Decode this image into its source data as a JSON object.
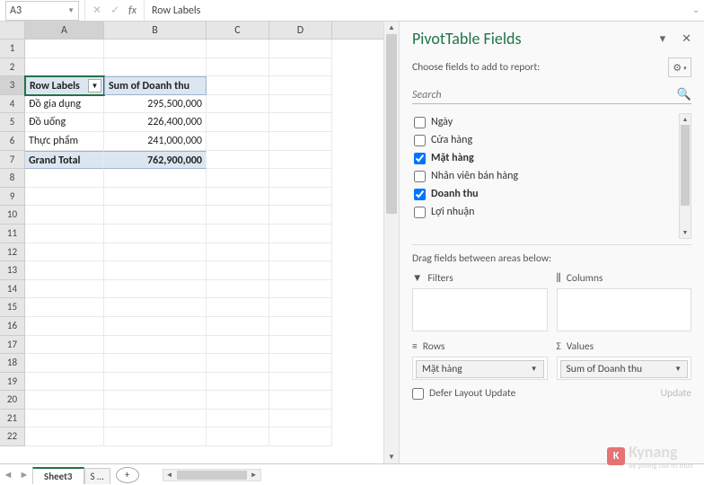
{
  "name_box": "A3",
  "formula": "Row Labels",
  "columns": [
    "A",
    "B",
    "C",
    "D"
  ],
  "pivot": {
    "headers": {
      "rows": "Row Labels",
      "values": "Sum of Doanh thu"
    },
    "rows": [
      {
        "label": "Đồ gia dụng",
        "value": "295,500,000"
      },
      {
        "label": "Đồ uống",
        "value": "226,400,000"
      },
      {
        "label": "Thực phẩm",
        "value": "241,000,000"
      }
    ],
    "total": {
      "label": "Grand Total",
      "value": "762,900,000"
    }
  },
  "sheets": {
    "active": "Sheet3",
    "next": "S …",
    "add": "+"
  },
  "panel": {
    "title": "PivotTable Fields",
    "subtitle": "Choose fields to add to report:",
    "search_placeholder": "Search",
    "fields": [
      {
        "name": "Ngày",
        "checked": false
      },
      {
        "name": "Cửa hàng",
        "checked": false
      },
      {
        "name": "Mặt hàng",
        "checked": true
      },
      {
        "name": "Nhân viên bán hàng",
        "checked": false
      },
      {
        "name": "Doanh thu",
        "checked": true
      },
      {
        "name": "Lợi nhuận",
        "checked": false
      }
    ],
    "areas_label": "Drag fields between areas below:",
    "areas": {
      "filters": "Filters",
      "columns": "Columns",
      "rows": "Rows",
      "values": "Values",
      "rows_chip": "Mặt hàng",
      "values_chip": "Sum of Doanh thu"
    },
    "defer": "Defer Layout Update",
    "update": "Update"
  },
  "watermark": {
    "brand": "Kynang",
    "tag": "Bệ phóng cho tri thức"
  }
}
